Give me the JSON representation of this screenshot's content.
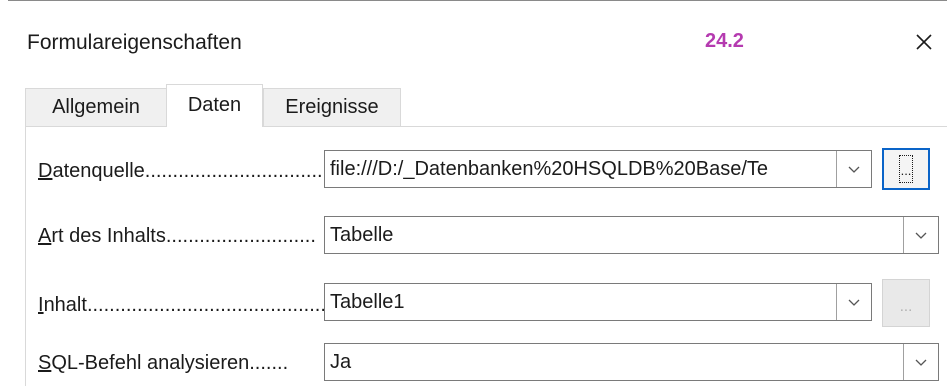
{
  "window": {
    "title": "Formulareigenschaften",
    "version": "24.2",
    "version_color": "#b53ab0",
    "close_icon": "close-icon"
  },
  "tabs": [
    {
      "label": "Allgemein",
      "active": false
    },
    {
      "label": "Daten",
      "active": true
    },
    {
      "label": "Ereignisse",
      "active": false
    }
  ],
  "fields": {
    "datenquelle": {
      "accesskey": "D",
      "label_rest": "atenquelle",
      "dots": "..................................",
      "value": "file:///D:/_Datenbanken%20HSQLDB%20Base/Te"
    },
    "art": {
      "accesskey": "A",
      "label_rest": "rt des Inhalts",
      "dots": "...........................",
      "value": "Tabelle"
    },
    "inhalt": {
      "accesskey": "I",
      "label_rest": "nhalt",
      "dots": "................................................",
      "value": "Tabelle1",
      "browse_label": "..."
    },
    "sql": {
      "accesskey": "S",
      "label_rest": "QL-Befehl analysieren",
      "dots": ".......",
      "value": "Ja"
    }
  },
  "browse_datenquelle_label": "..."
}
